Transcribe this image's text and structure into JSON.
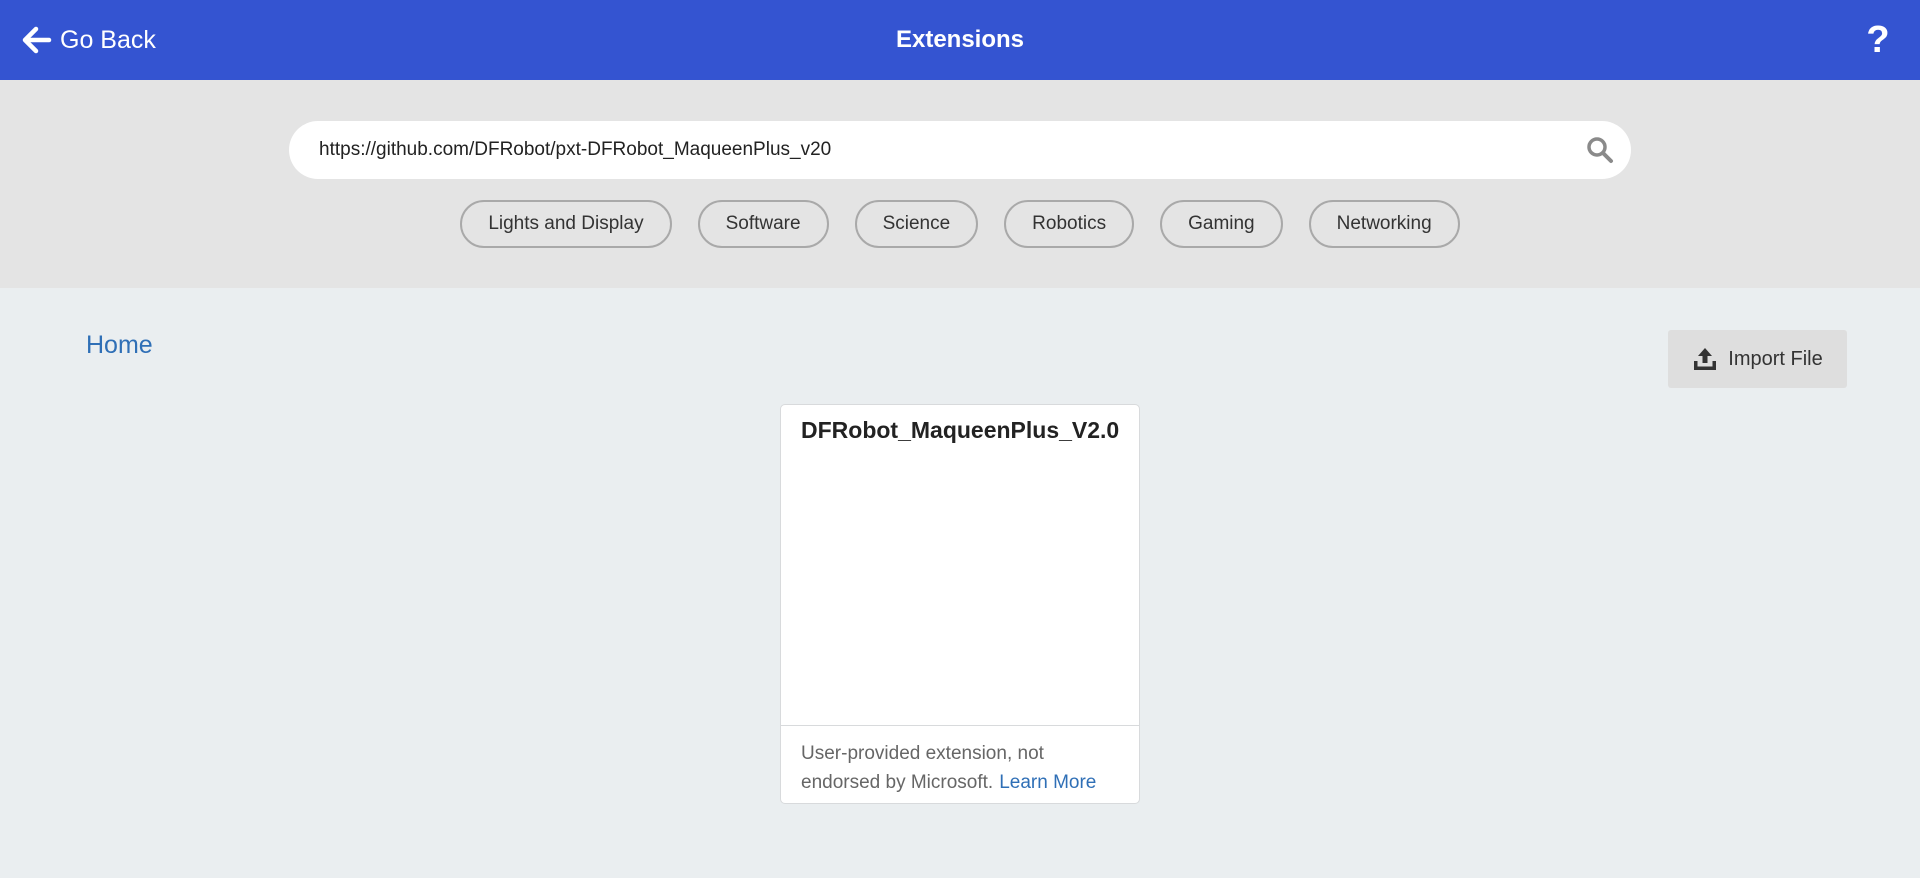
{
  "header": {
    "back_label": "Go Back",
    "title": "Extensions",
    "help_label": "?"
  },
  "search": {
    "value": "https://github.com/DFRobot/pxt-DFRobot_MaqueenPlus_v20",
    "placeholder": ""
  },
  "categories": [
    "Lights and Display",
    "Software",
    "Science",
    "Robotics",
    "Gaming",
    "Networking"
  ],
  "breadcrumb": {
    "home_label": "Home"
  },
  "import": {
    "label": "Import File"
  },
  "result_card": {
    "title": "DFRobot_MaqueenPlus_V2.0",
    "disclaimer": "User-provided extension, not endorsed by Microsoft.",
    "learn_more_label": "Learn More"
  },
  "colors": {
    "header_bg": "#3454d1",
    "search_area_bg": "#e4e4e4",
    "page_bg": "#eaeef0",
    "link": "#2f6fb6"
  },
  "icons": {
    "back": "arrow-left-icon",
    "search": "search-icon",
    "import": "upload-icon"
  }
}
